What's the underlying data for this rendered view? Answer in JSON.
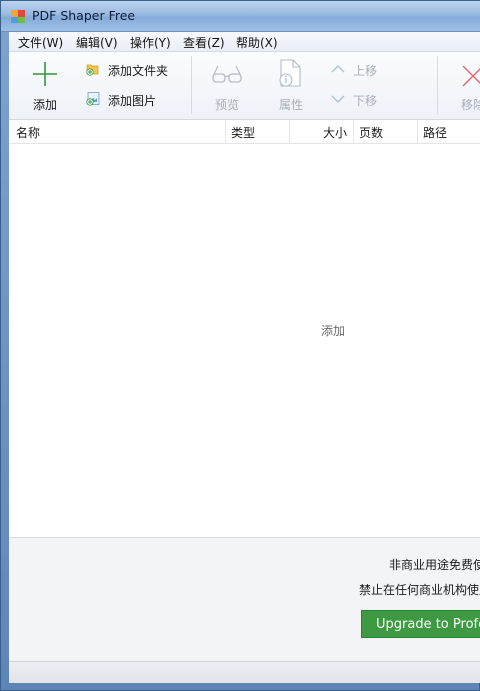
{
  "window": {
    "title": "PDF Shaper Free"
  },
  "menu": [
    "文件(W)",
    "编辑(V)",
    "操作(Y)",
    "查看(Z)",
    "帮助(X)"
  ],
  "toolbar": {
    "add": "添加",
    "add_folder": "添加文件夹",
    "add_image": "添加图片",
    "preview": "预览",
    "properties": "属性",
    "move_up": "上移",
    "move_down": "下移",
    "remove": "移除"
  },
  "columns": [
    "名称",
    "类型",
    "大小",
    "页数",
    "路径"
  ],
  "file_list": {
    "placeholder": "添加"
  },
  "footer": {
    "notice_line1": "非商业用途免费使用",
    "notice_line2": "禁止在任何商业机构使用",
    "upgrade_label": "Upgrade to Professional"
  },
  "colors": {
    "accent_green": "#3d9a42",
    "add_icon_green": "#2e9a3a",
    "remove_icon_red": "#e06a6a"
  }
}
